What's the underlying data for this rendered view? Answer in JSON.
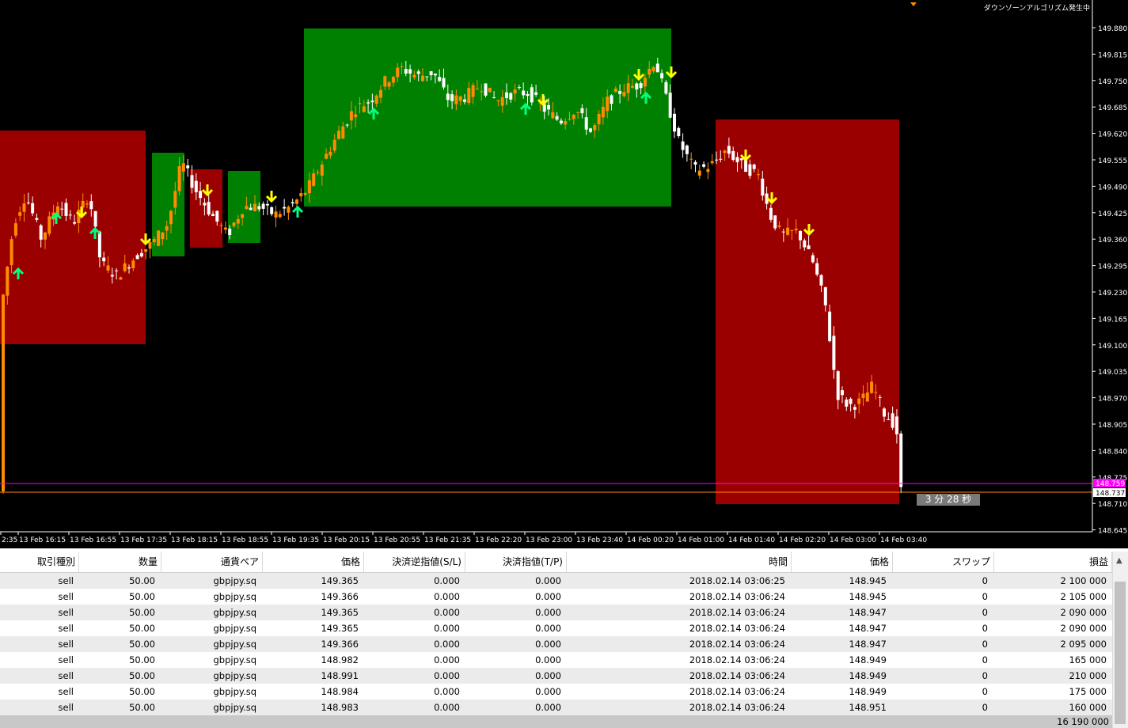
{
  "chart": {
    "indicator_title": "ダウンゾーンアルゴリズム発生中",
    "countdown": "3 分 28 秒",
    "price_axis": [
      "149.880",
      "149.815",
      "149.750",
      "149.685",
      "149.620",
      "149.555",
      "149.490",
      "149.425",
      "149.360",
      "149.295",
      "149.230",
      "149.165",
      "149.100",
      "149.035",
      "148.970",
      "148.905",
      "148.840",
      "148.775",
      "148.710",
      "148.645"
    ],
    "price_labels": {
      "magenta": "148.759",
      "white": "148.737"
    },
    "time_axis": [
      "2:35",
      "13 Feb 16:15",
      "13 Feb 16:55",
      "13 Feb 17:35",
      "13 Feb 18:15",
      "13 Feb 18:55",
      "13 Feb 19:35",
      "13 Feb 20:15",
      "13 Feb 20:55",
      "13 Feb 21:35",
      "13 Feb 22:20",
      "13 Feb 23:00",
      "13 Feb 23:40",
      "14 Feb 00:20",
      "14 Feb 01:00",
      "14 Feb 01:40",
      "14 Feb 02:20",
      "14 Feb 03:00",
      "14 Feb 03:40"
    ],
    "colors": {
      "background": "#000000",
      "bull": "#ff8c00",
      "bear": "#ffffff",
      "up_zone": "#008000",
      "down_zone": "#9b0000",
      "buy_arrow": "#00ff80",
      "sell_arrow": "#ffff00",
      "magenta_line": "#ff00ff",
      "orange_line": "#ff8c00"
    }
  },
  "table": {
    "headers": [
      "取引種別",
      "数量",
      "通貨ペア",
      "価格",
      "決済逆指値(S/L)",
      "決済指値(T/P)",
      "時間",
      "価格",
      "スワップ",
      "損益"
    ],
    "rows": [
      [
        "sell",
        "50.00",
        "gbpjpy.sq",
        "149.365",
        "0.000",
        "0.000",
        "2018.02.14 03:06:25",
        "148.945",
        "0",
        "2 100 000"
      ],
      [
        "sell",
        "50.00",
        "gbpjpy.sq",
        "149.366",
        "0.000",
        "0.000",
        "2018.02.14 03:06:24",
        "148.945",
        "0",
        "2 105 000"
      ],
      [
        "sell",
        "50.00",
        "gbpjpy.sq",
        "149.365",
        "0.000",
        "0.000",
        "2018.02.14 03:06:24",
        "148.947",
        "0",
        "2 090 000"
      ],
      [
        "sell",
        "50.00",
        "gbpjpy.sq",
        "149.365",
        "0.000",
        "0.000",
        "2018.02.14 03:06:24",
        "148.947",
        "0",
        "2 090 000"
      ],
      [
        "sell",
        "50.00",
        "gbpjpy.sq",
        "149.366",
        "0.000",
        "0.000",
        "2018.02.14 03:06:24",
        "148.947",
        "0",
        "2 095 000"
      ],
      [
        "sell",
        "50.00",
        "gbpjpy.sq",
        "148.982",
        "0.000",
        "0.000",
        "2018.02.14 03:06:24",
        "148.949",
        "0",
        "165 000"
      ],
      [
        "sell",
        "50.00",
        "gbpjpy.sq",
        "148.991",
        "0.000",
        "0.000",
        "2018.02.14 03:06:24",
        "148.949",
        "0",
        "210 000"
      ],
      [
        "sell",
        "50.00",
        "gbpjpy.sq",
        "148.984",
        "0.000",
        "0.000",
        "2018.02.14 03:06:24",
        "148.949",
        "0",
        "175 000"
      ],
      [
        "sell",
        "50.00",
        "gbpjpy.sq",
        "148.983",
        "0.000",
        "0.000",
        "2018.02.14 03:06:24",
        "148.951",
        "0",
        "160 000"
      ]
    ],
    "total": "16 190 000"
  }
}
